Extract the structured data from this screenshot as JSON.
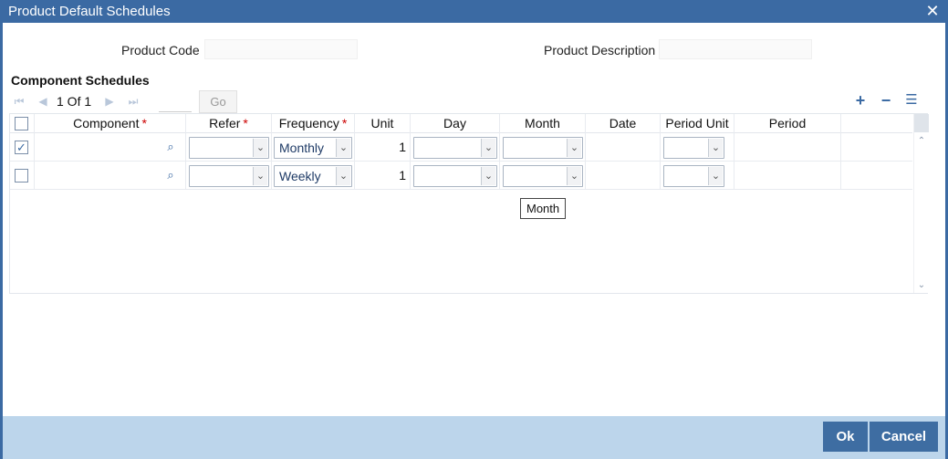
{
  "window": {
    "title": "Product Default Schedules",
    "close_icon": "close-icon"
  },
  "header": {
    "product_code_label": "Product Code",
    "product_code_value": "",
    "product_description_label": "Product Description",
    "product_description_value": ""
  },
  "section": {
    "title": "Component Schedules"
  },
  "pagination": {
    "text": "1 Of 1",
    "go_label": "Go"
  },
  "toolbar": {
    "add": "+",
    "remove": "−",
    "view": "☰"
  },
  "table": {
    "columns": {
      "component": "Component",
      "refer": "Refer",
      "frequency": "Frequency",
      "unit": "Unit",
      "day": "Day",
      "month": "Month",
      "date": "Date",
      "period_unit": "Period Unit",
      "period": "Period"
    },
    "required_marker": "*",
    "rows": [
      {
        "checked": true,
        "component": "",
        "refer": "",
        "frequency": "Monthly",
        "unit": "1",
        "day": "",
        "month": "",
        "date": "",
        "period_unit": "",
        "period": ""
      },
      {
        "checked": false,
        "component": "",
        "refer": "",
        "frequency": "Weekly",
        "unit": "1",
        "day": "",
        "month": "",
        "date": "",
        "period_unit": "",
        "period": ""
      }
    ]
  },
  "tooltip": {
    "text": "Month"
  },
  "footer": {
    "ok_label": "Ok",
    "cancel_label": "Cancel"
  },
  "colors": {
    "titlebar": "#3b6aa3",
    "footer": "#bcd5eb",
    "button": "#3e6da2"
  }
}
